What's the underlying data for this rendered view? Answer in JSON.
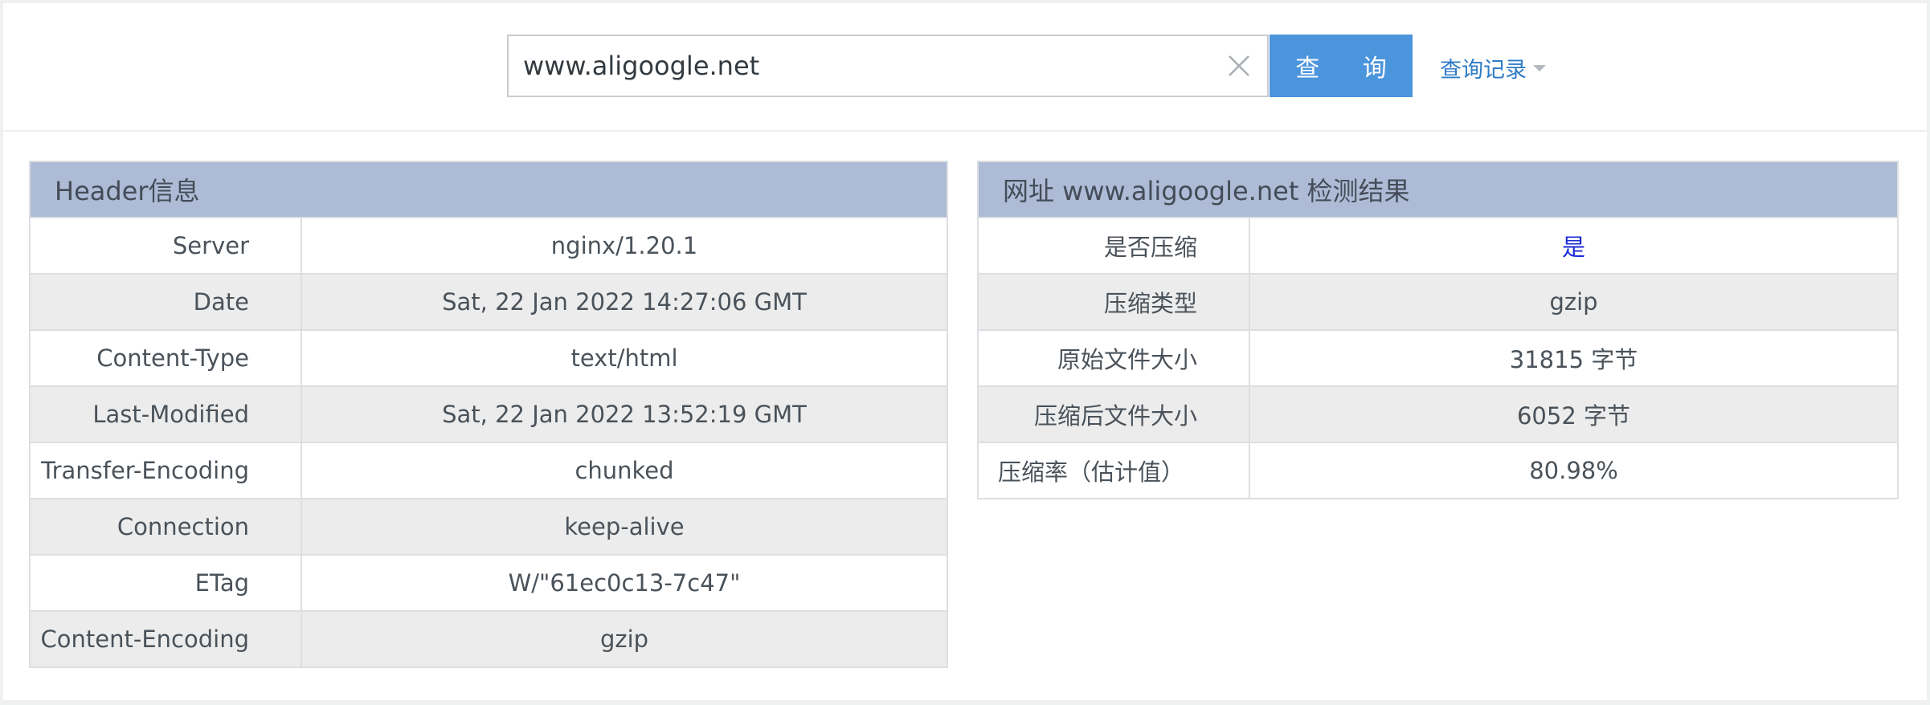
{
  "search": {
    "value": "www.aligoogle.net",
    "button_label": "查 询",
    "history_label": "查询记录"
  },
  "header_panel": {
    "title": "Header信息",
    "rows": [
      {
        "key": "Server",
        "value": "nginx/1.20.1"
      },
      {
        "key": "Date",
        "value": "Sat, 22 Jan 2022 14:27:06 GMT"
      },
      {
        "key": "Content-Type",
        "value": "text/html"
      },
      {
        "key": "Last-Modified",
        "value": "Sat, 22 Jan 2022 13:52:19 GMT"
      },
      {
        "key": "Transfer-Encoding",
        "value": "chunked"
      },
      {
        "key": "Connection",
        "value": "keep-alive"
      },
      {
        "key": "ETag",
        "value": "W/\"61ec0c13-7c47\""
      },
      {
        "key": "Content-Encoding",
        "value": "gzip"
      }
    ]
  },
  "result_panel": {
    "title": "网址 www.aligoogle.net 检测结果",
    "rows": [
      {
        "key": "是否压缩",
        "value": "是"
      },
      {
        "key": "压缩类型",
        "value": "gzip"
      },
      {
        "key": "原始文件大小",
        "value": "31815 字节"
      },
      {
        "key": "压缩后文件大小",
        "value": "6052 字节"
      },
      {
        "key": "压缩率（估计值）",
        "value": "80.98%"
      }
    ]
  },
  "colors": {
    "accent": "#4b95dd",
    "link": "#2f7bc6",
    "table_header_bg": "#aebbd6",
    "row_alt_bg": "#ececec",
    "yes_text": "#1a2bd6"
  },
  "icons": {
    "clear": "close-icon",
    "dropdown": "caret-down-icon"
  }
}
